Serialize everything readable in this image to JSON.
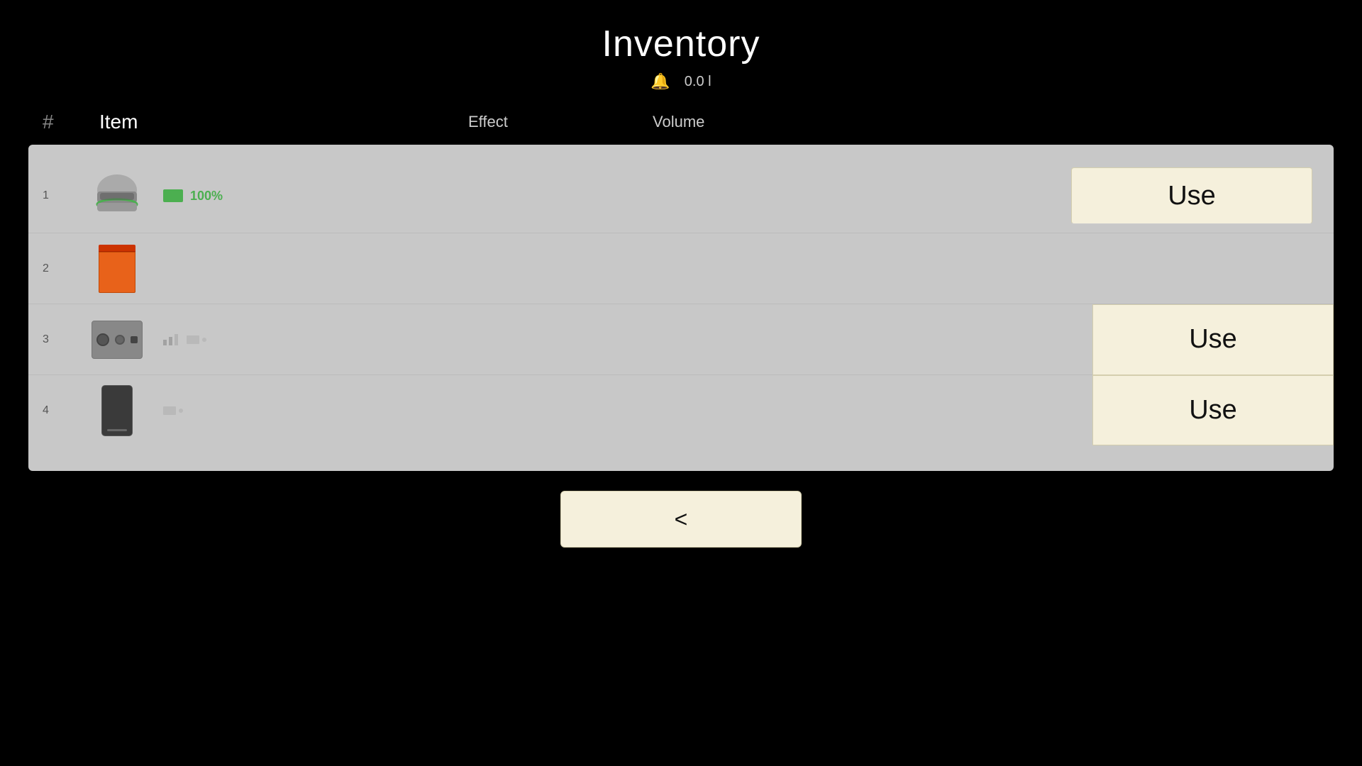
{
  "page": {
    "title": "Inventory",
    "back_button_label": "<",
    "stats": {
      "bell": "🔔",
      "value": "0.0 l"
    },
    "columns": {
      "number": "#",
      "item": "Item",
      "effect": "Effect",
      "volume": "Volume"
    },
    "use_button_label": "Use"
  },
  "items": [
    {
      "id": 1,
      "icon_type": "helmet",
      "effect_type": "bar_green",
      "effect_value": "100%",
      "has_use_button": true,
      "use_count": 1
    },
    {
      "id": 2,
      "icon_type": "orange_box",
      "effect_type": "none",
      "effect_value": "",
      "has_use_button": false,
      "use_count": 0
    },
    {
      "id": 3,
      "icon_type": "radio",
      "effect_type": "small_bars",
      "effect_value": "",
      "has_use_button": true,
      "use_count": 1
    },
    {
      "id": 4,
      "icon_type": "phone",
      "effect_type": "small_bars2",
      "effect_value": "",
      "has_use_button": true,
      "use_count": 1
    }
  ]
}
